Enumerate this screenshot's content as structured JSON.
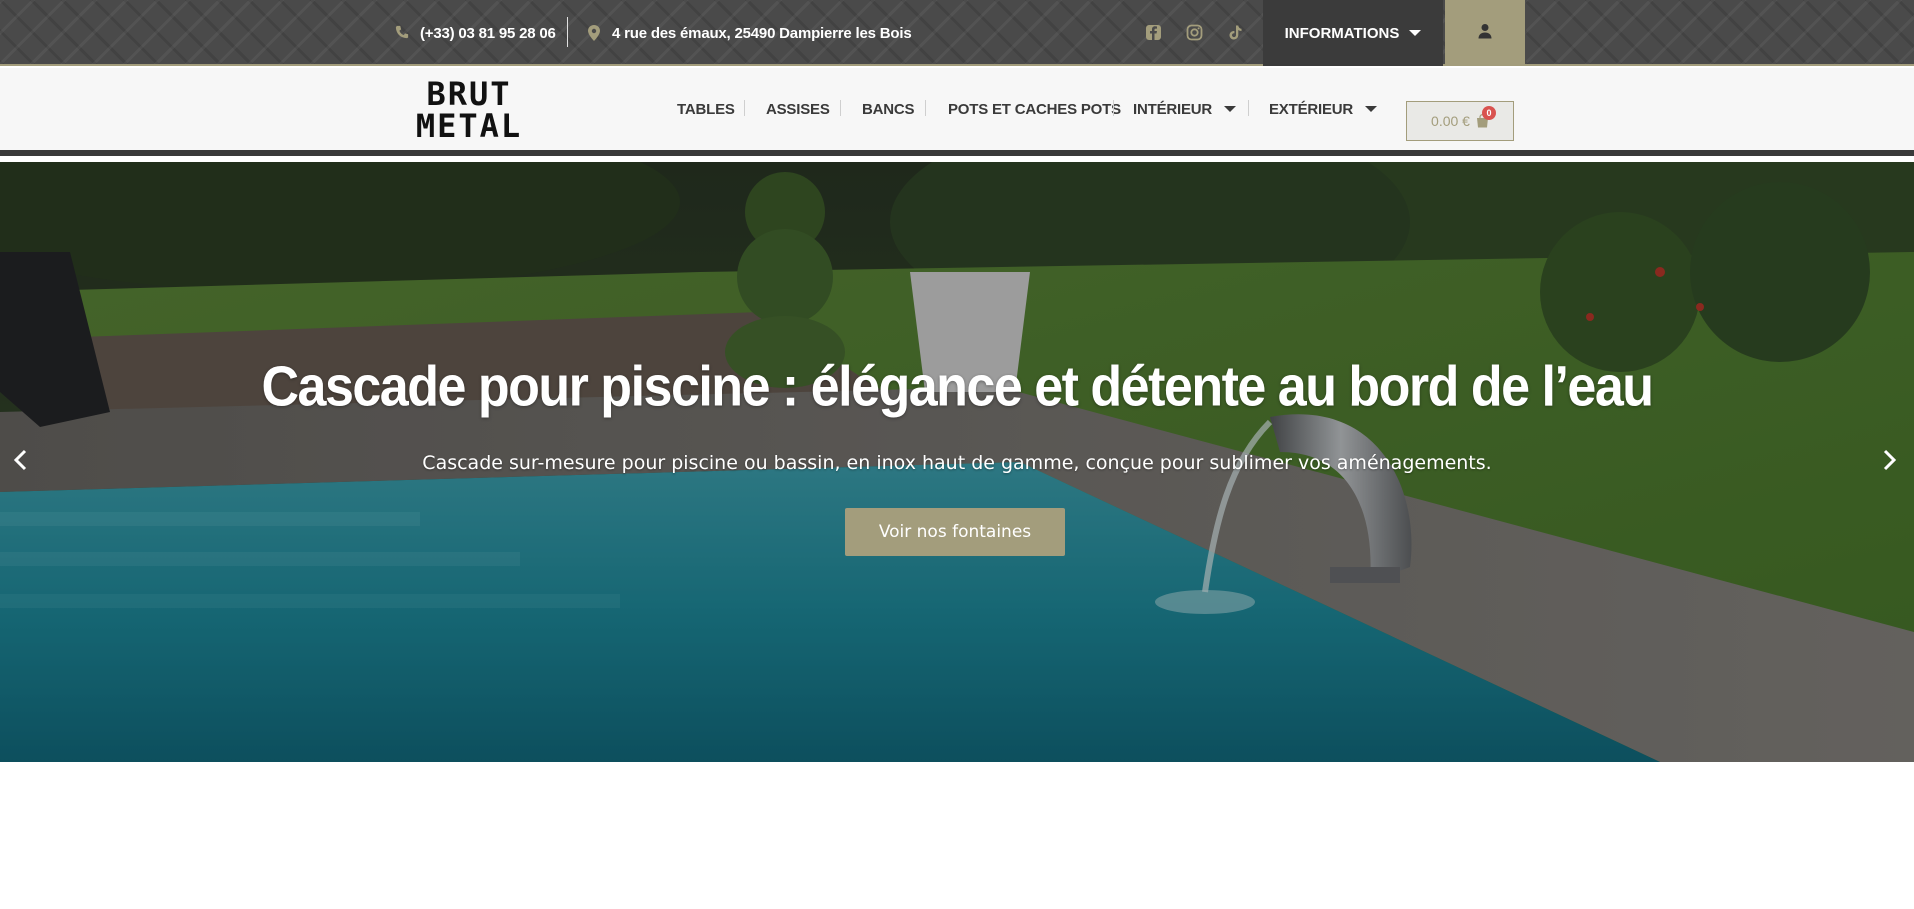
{
  "topbar": {
    "phone": "(+33) 03 81 95 28 06",
    "address": "4 rue des émaux, 25490 Dampierre les Bois",
    "socials": [
      "facebook-icon",
      "instagram-icon",
      "tiktok-icon"
    ],
    "info_label": "INFORMATIONS",
    "accent": "#a39d7c"
  },
  "brand": {
    "line1": "BRUT",
    "line2": "METAL"
  },
  "nav": {
    "items": [
      {
        "label": "TABLES"
      },
      {
        "label": "ASSISES"
      },
      {
        "label": "BANCS"
      },
      {
        "label": "POTS ET CACHES POTS"
      },
      {
        "label": "INTÉRIEUR"
      },
      {
        "label": "EXTÉRIEUR"
      }
    ],
    "cart_total": "0.00 €",
    "cart_count": "0"
  },
  "hero": {
    "title": "Cascade pour piscine : élégance et détente au bord de l’eau",
    "subtitle": "Cascade sur-mesure pour piscine ou bassin, en inox haut de gamme, conçue pour sublimer vos aménagements.",
    "button_label": "Voir nos fontaines"
  }
}
